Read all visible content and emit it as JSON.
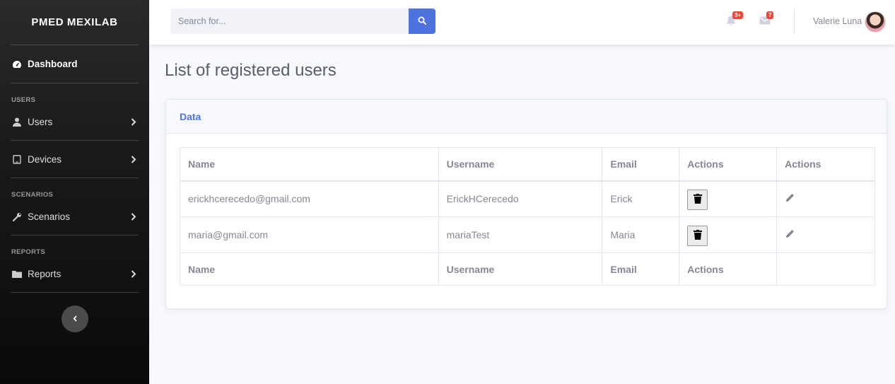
{
  "sidebar": {
    "brand": "PMED MEXILAB",
    "dashboard_label": "Dashboard",
    "headings": [
      "USERS",
      "SCENARIOS",
      "REPORTS"
    ],
    "items": [
      {
        "label": "Users",
        "icon": "user-icon"
      },
      {
        "label": "Devices",
        "icon": "tablet-icon"
      },
      {
        "label": "Scenarios",
        "icon": "wrench-icon"
      },
      {
        "label": "Reports",
        "icon": "folder-icon"
      }
    ]
  },
  "topbar": {
    "search_placeholder": "Search for...",
    "alerts_badge": "3+",
    "messages_badge": "7",
    "user_name": "Valerie Luna"
  },
  "main": {
    "page_title": "List of registered users",
    "card_title": "Data",
    "table": {
      "headers": [
        "Name",
        "Username",
        "Email",
        "Actions",
        "Actions"
      ],
      "rows": [
        [
          "erickhcerecedo@gmail.com",
          "ErickHCerecedo",
          "Erick"
        ],
        [
          "maria@gmail.com",
          "mariaTest",
          "Maria"
        ]
      ],
      "footers": [
        "Name",
        "Username",
        "Email",
        "Actions",
        ""
      ]
    }
  },
  "colors": {
    "primary": "#4e73df",
    "danger": "#e74a3b",
    "text_muted": "#858796"
  }
}
